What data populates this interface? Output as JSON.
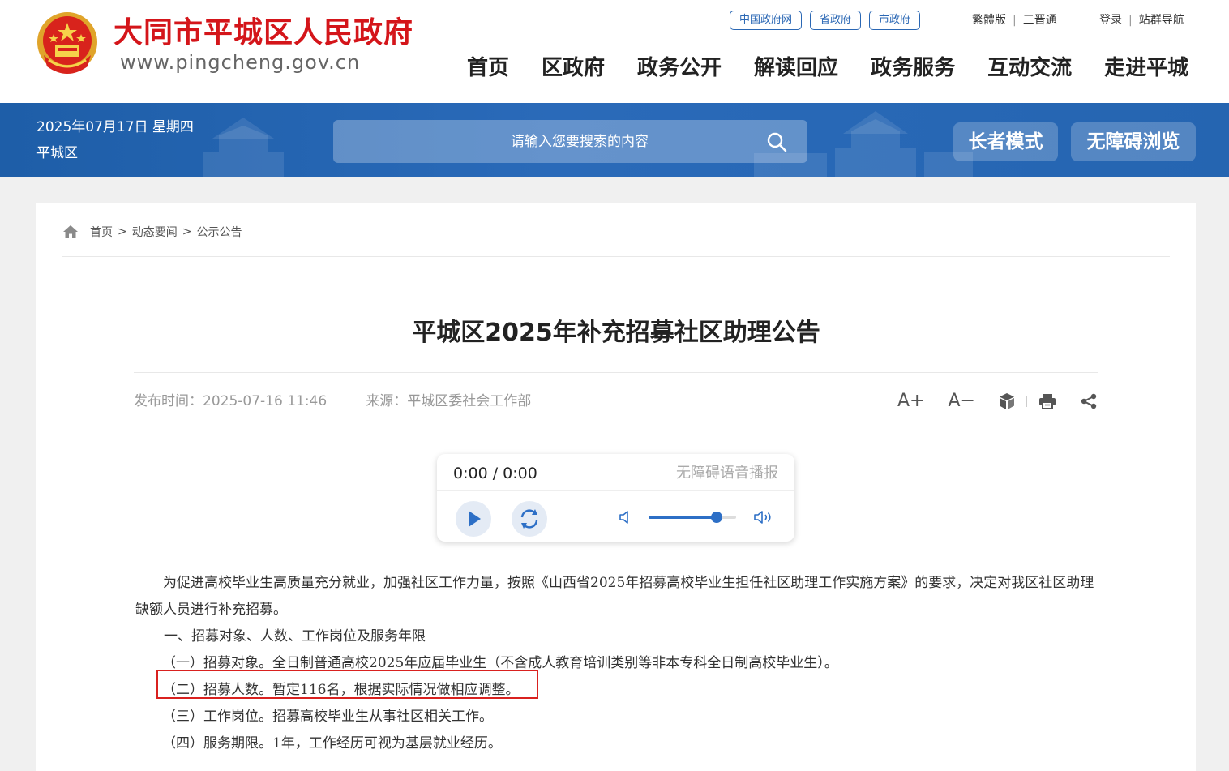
{
  "header": {
    "site_title": "大同市平城区人民政府",
    "site_url": "www.pingcheng.gov.cn",
    "top_links": [
      "中国政府网",
      "省政府",
      "市政府"
    ],
    "util_links": [
      "繁體版",
      "三晋通"
    ],
    "account_links": [
      "登录",
      "站群导航"
    ],
    "nav": [
      "首页",
      "区政府",
      "政务公开",
      "解读回应",
      "政务服务",
      "互动交流",
      "走进平城"
    ]
  },
  "banner": {
    "date": "2025年07月17日 星期四",
    "region": "平城区",
    "search_placeholder": "请输入您要搜索的内容",
    "elder_mode": "长者模式",
    "accessible": "无障碍浏览"
  },
  "breadcrumb": [
    "首页",
    "动态要闻",
    "公示公告"
  ],
  "article": {
    "title": "平城区2025年补充招募社区助理公告",
    "publish_time": "发布时间：2025-07-16 11:46",
    "source": "来源：平城区委社会工作部",
    "tools": {
      "font_up": "A+",
      "font_down": "A−"
    },
    "paragraphs": [
      "为促进高校毕业生高质量充分就业，加强社区工作力量，按照《山西省2025年招募高校毕业生担任社区助理工作实施方案》的要求，决定对我区社区助理缺额人员进行补充招募。",
      "一、招募对象、人数、工作岗位及服务年限",
      "（一）招募对象。全日制普通高校2025年应届毕业生（不含成人教育培训类别等非本专科全日制高校毕业生）。",
      "（二）招募人数。暂定116名，根据实际情况做相应调整。",
      "（三）工作岗位。招募高校毕业生从事社区相关工作。",
      "（四）服务期限。1年，工作经历可视为基层就业经历。"
    ]
  },
  "player": {
    "time": "0:00 / 0:00",
    "title": "无障碍语音播报",
    "volume": 0.78
  },
  "colors": {
    "title_red": "#d4151a",
    "banner_blue": "#2565b1",
    "link_blue": "#2a67b4",
    "highlight_red": "#d9211f"
  }
}
